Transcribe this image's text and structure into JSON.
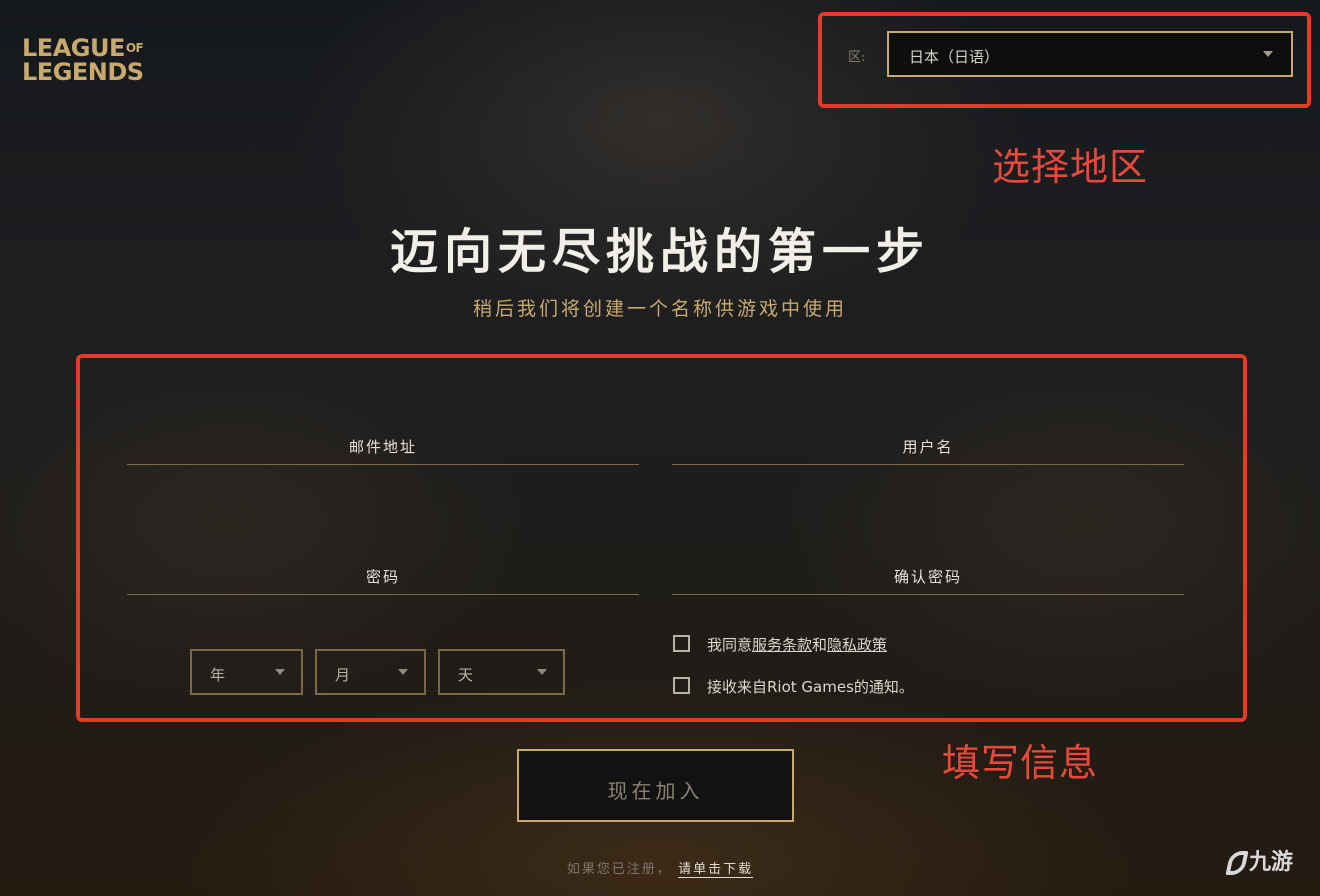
{
  "logo": {
    "line1": "LEAGUE",
    "line1_small": "OF",
    "line2": "LEGENDS"
  },
  "region": {
    "label": "区:",
    "selected": "日本（日语）"
  },
  "annotations": {
    "region_note": "选择地区",
    "form_note": "填写信息",
    "color": "#e03c28"
  },
  "headline": "迈向无尽挑战的第一步",
  "subtitle": "稍后我们将创建一个名称供游戏中使用",
  "form": {
    "email_label": "邮件地址",
    "username_label": "用户名",
    "password_label": "密码",
    "confirm_password_label": "确认密码",
    "year_placeholder": "年",
    "month_placeholder": "月",
    "day_placeholder": "天",
    "terms_prefix": "我同意",
    "terms_link": "服务条款",
    "terms_and": "和",
    "privacy_link": "隐私政策",
    "newsletter_text": "接收来自Riot Games的通知。"
  },
  "join_button": "现在加入",
  "footer": {
    "text": "如果您已注册，",
    "download_link": "请单击下载"
  },
  "watermark": "九游",
  "colors": {
    "gold": "#c8aa6e",
    "background": "#1d1e20"
  }
}
